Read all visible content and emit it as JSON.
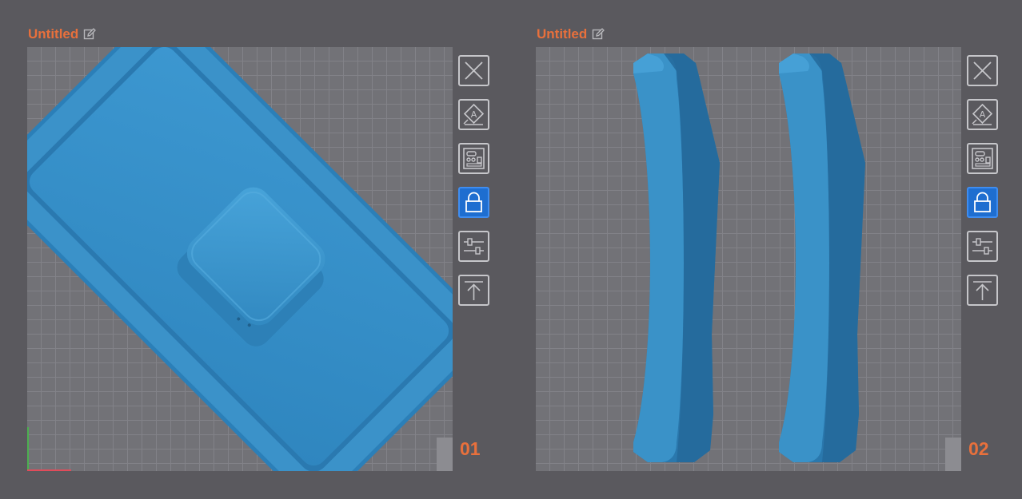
{
  "panels": [
    {
      "title": "Untitled",
      "number": "01"
    },
    {
      "title": "Untitled",
      "number": "02"
    }
  ],
  "toolbar": {
    "tools": [
      {
        "name": "close",
        "icon": "close-icon",
        "active": false
      },
      {
        "name": "orient",
        "icon": "orient-icon",
        "active": false
      },
      {
        "name": "arrange",
        "icon": "arrange-icon",
        "active": false
      },
      {
        "name": "lock",
        "icon": "lock-icon",
        "active": true
      },
      {
        "name": "settings",
        "icon": "sliders-icon",
        "active": false
      },
      {
        "name": "export",
        "icon": "export-icon",
        "active": false
      }
    ]
  },
  "colors": {
    "background": "#5a595e",
    "viewport": "#727277",
    "grid": "#828288",
    "title_accent": "#e8703c",
    "model_blue": "#3a8fc7",
    "active_tool": "#1e6ed0"
  }
}
